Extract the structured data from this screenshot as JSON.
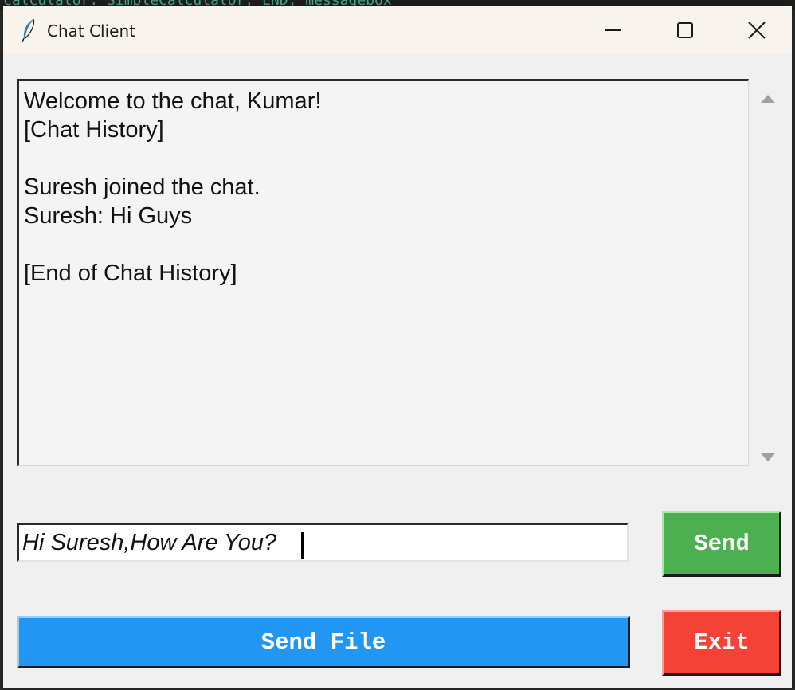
{
  "window": {
    "title": "Chat Client"
  },
  "chat": {
    "lines": [
      "Welcome to the chat, Kumar!",
      "[Chat History]",
      "",
      "Suresh joined the chat.",
      "Suresh: Hi Guys",
      "",
      "[End of Chat History]"
    ]
  },
  "message_input": {
    "value": "Hi Suresh,How Are You?"
  },
  "buttons": {
    "send": "Send",
    "send_file": "Send File",
    "exit": "Exit"
  },
  "colors": {
    "send": "#4caf50",
    "send_file": "#2196f3",
    "exit": "#f44336"
  },
  "icons": {
    "app": "feather-icon",
    "minimize": "minimize-icon",
    "maximize": "maximize-icon",
    "close": "close-icon"
  }
}
